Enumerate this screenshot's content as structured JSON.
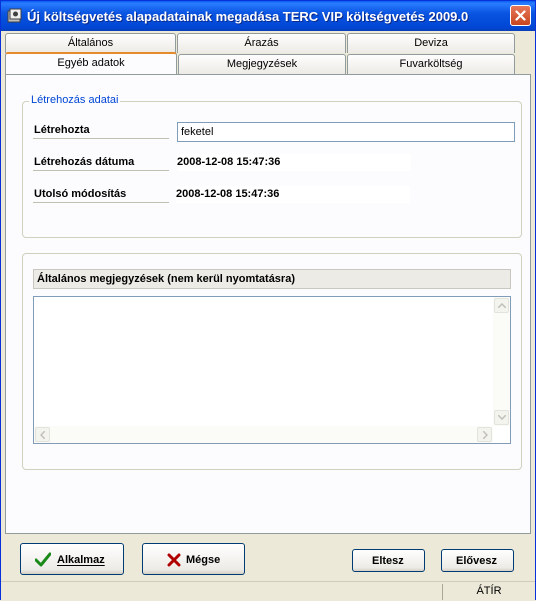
{
  "window": {
    "title": "Új költségvetés alapadatainak megadása   TERC VIP költségvetés 2009.0"
  },
  "tabs": {
    "row1": [
      "Általános",
      "Árazás",
      "Deviza"
    ],
    "row2": [
      "Egyéb adatok",
      "Megjegyzések",
      "Fuvarköltség"
    ],
    "active": "Egyéb adatok"
  },
  "creation": {
    "group_title": "Létrehozás adatai",
    "created_by_label": "Létrehozta",
    "created_by_value": "feketel",
    "created_date_label": "Létrehozás dátuma",
    "created_date_value": "2008-12-08 15:47:36",
    "modified_label": "Utolsó módosítás",
    "modified_value": "2008-12-08 15:47:36"
  },
  "notes": {
    "label": "Általános megjegyzések (nem kerül nyomtatásra)",
    "value": ""
  },
  "buttons": {
    "apply": "Alkalmaz",
    "cancel": "Mégse",
    "prev": "Eltesz",
    "next": "Elővesz"
  },
  "status": {
    "mode": "ÁTÍR"
  },
  "icons": {
    "apply": "check-icon",
    "cancel": "x-icon",
    "close": "close-icon"
  },
  "colors": {
    "titlebar": "#0054e3",
    "accent_tab": "#e68b2c",
    "group_title": "#0046d5",
    "close_button": "#c7451e"
  }
}
